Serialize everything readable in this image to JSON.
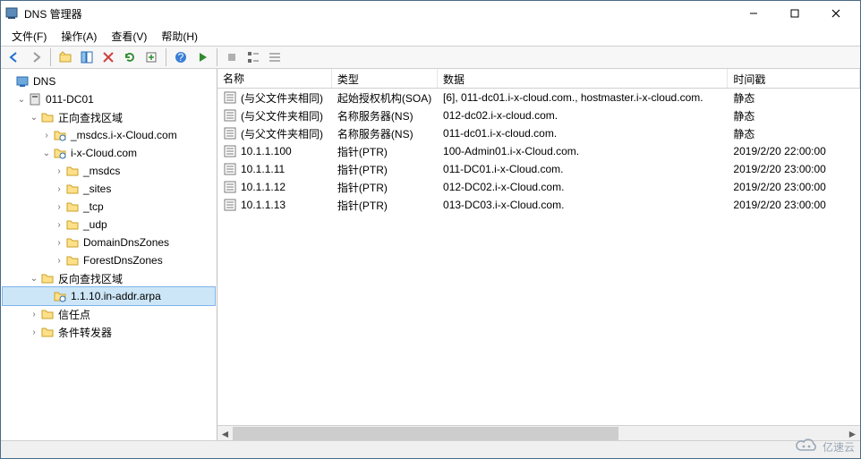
{
  "titlebar": {
    "title": "DNS 管理器"
  },
  "menu": {
    "file": "文件(F)",
    "action": "操作(A)",
    "view": "查看(V)",
    "help": "帮助(H)"
  },
  "toolbar_icons": {
    "back": "back-arrow-icon",
    "forward": "forward-arrow-icon",
    "up": "up-folder-icon",
    "show": "panel-icon",
    "props": "properties-icon",
    "refresh": "refresh-icon",
    "export": "export-icon",
    "help": "help-icon",
    "run": "run-icon",
    "stop": "stop-icon",
    "list1": "list-icon",
    "list2": "list-small-icon",
    "list3": "details-icon"
  },
  "tree": {
    "root": "DNS",
    "server": "011-DC01",
    "fwd_zone": "正向查找区域",
    "msdcs_zone": "_msdcs.i-x-Cloud.com",
    "domain_zone": "i-x-Cloud.com",
    "sub": {
      "msdcs": "_msdcs",
      "sites": "_sites",
      "tcp": "_tcp",
      "udp": "_udp",
      "ddz": "DomainDnsZones",
      "fdz": "ForestDnsZones"
    },
    "rev_zone": "反向查找区域",
    "rev_item": "1.1.10.in-addr.arpa",
    "trust": "信任点",
    "cond": "条件转发器"
  },
  "columns": {
    "name": "名称",
    "type": "类型",
    "data": "数据",
    "time": "时间戳"
  },
  "rows": [
    {
      "name": "(与父文件夹相同)",
      "type": "起始授权机构(SOA)",
      "data": "[6], 011-dc01.i-x-cloud.com., hostmaster.i-x-cloud.com.",
      "time": "静态"
    },
    {
      "name": "(与父文件夹相同)",
      "type": "名称服务器(NS)",
      "data": "012-dc02.i-x-cloud.com.",
      "time": "静态"
    },
    {
      "name": "(与父文件夹相同)",
      "type": "名称服务器(NS)",
      "data": "011-dc01.i-x-cloud.com.",
      "time": "静态"
    },
    {
      "name": "10.1.1.100",
      "type": "指针(PTR)",
      "data": "100-Admin01.i-x-Cloud.com.",
      "time": "2019/2/20 22:00:00"
    },
    {
      "name": "10.1.1.11",
      "type": "指针(PTR)",
      "data": "011-DC01.i-x-Cloud.com.",
      "time": "2019/2/20 23:00:00"
    },
    {
      "name": "10.1.1.12",
      "type": "指针(PTR)",
      "data": "012-DC02.i-x-Cloud.com.",
      "time": "2019/2/20 23:00:00"
    },
    {
      "name": "10.1.1.13",
      "type": "指针(PTR)",
      "data": "013-DC03.i-x-Cloud.com.",
      "time": "2019/2/20 23:00:00"
    }
  ],
  "watermark": "亿速云"
}
